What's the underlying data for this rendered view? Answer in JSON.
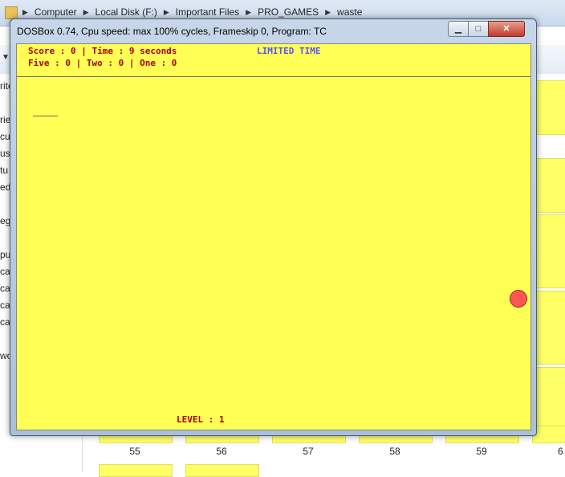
{
  "breadcrumb": [
    "Computer",
    "Local Disk (F:)",
    "Important Files",
    "PRO_GAMES",
    "waste"
  ],
  "nav_pane": [
    "rite",
    "rie",
    "cu",
    "usi",
    "tu",
    "ed",
    "eg",
    "pu",
    "cal",
    "cal",
    "cal",
    "cal",
    "wo"
  ],
  "thumbnails": {
    "labels": [
      "55",
      "56",
      "57",
      "58",
      "59",
      "6"
    ]
  },
  "window": {
    "title": "DOSBox 0.74, Cpu speed: max 100% cycles, Frameskip  0, Program:     TC",
    "minimize_icon": "minimize-icon",
    "maximize_icon": "maximize-icon",
    "close_icon": "close-icon"
  },
  "game": {
    "line1": "Score : 0 | Time : 9 seconds",
    "mode": "LIMITED TIME",
    "line2": "Five : 0 | Two : 0 | One : 0",
    "level": "LEVEL : 1"
  },
  "colors": {
    "screen_background": "#ffff55",
    "hud_text": "#aa0000",
    "hud_accent": "#5555ff",
    "ball": "#ff5555"
  }
}
